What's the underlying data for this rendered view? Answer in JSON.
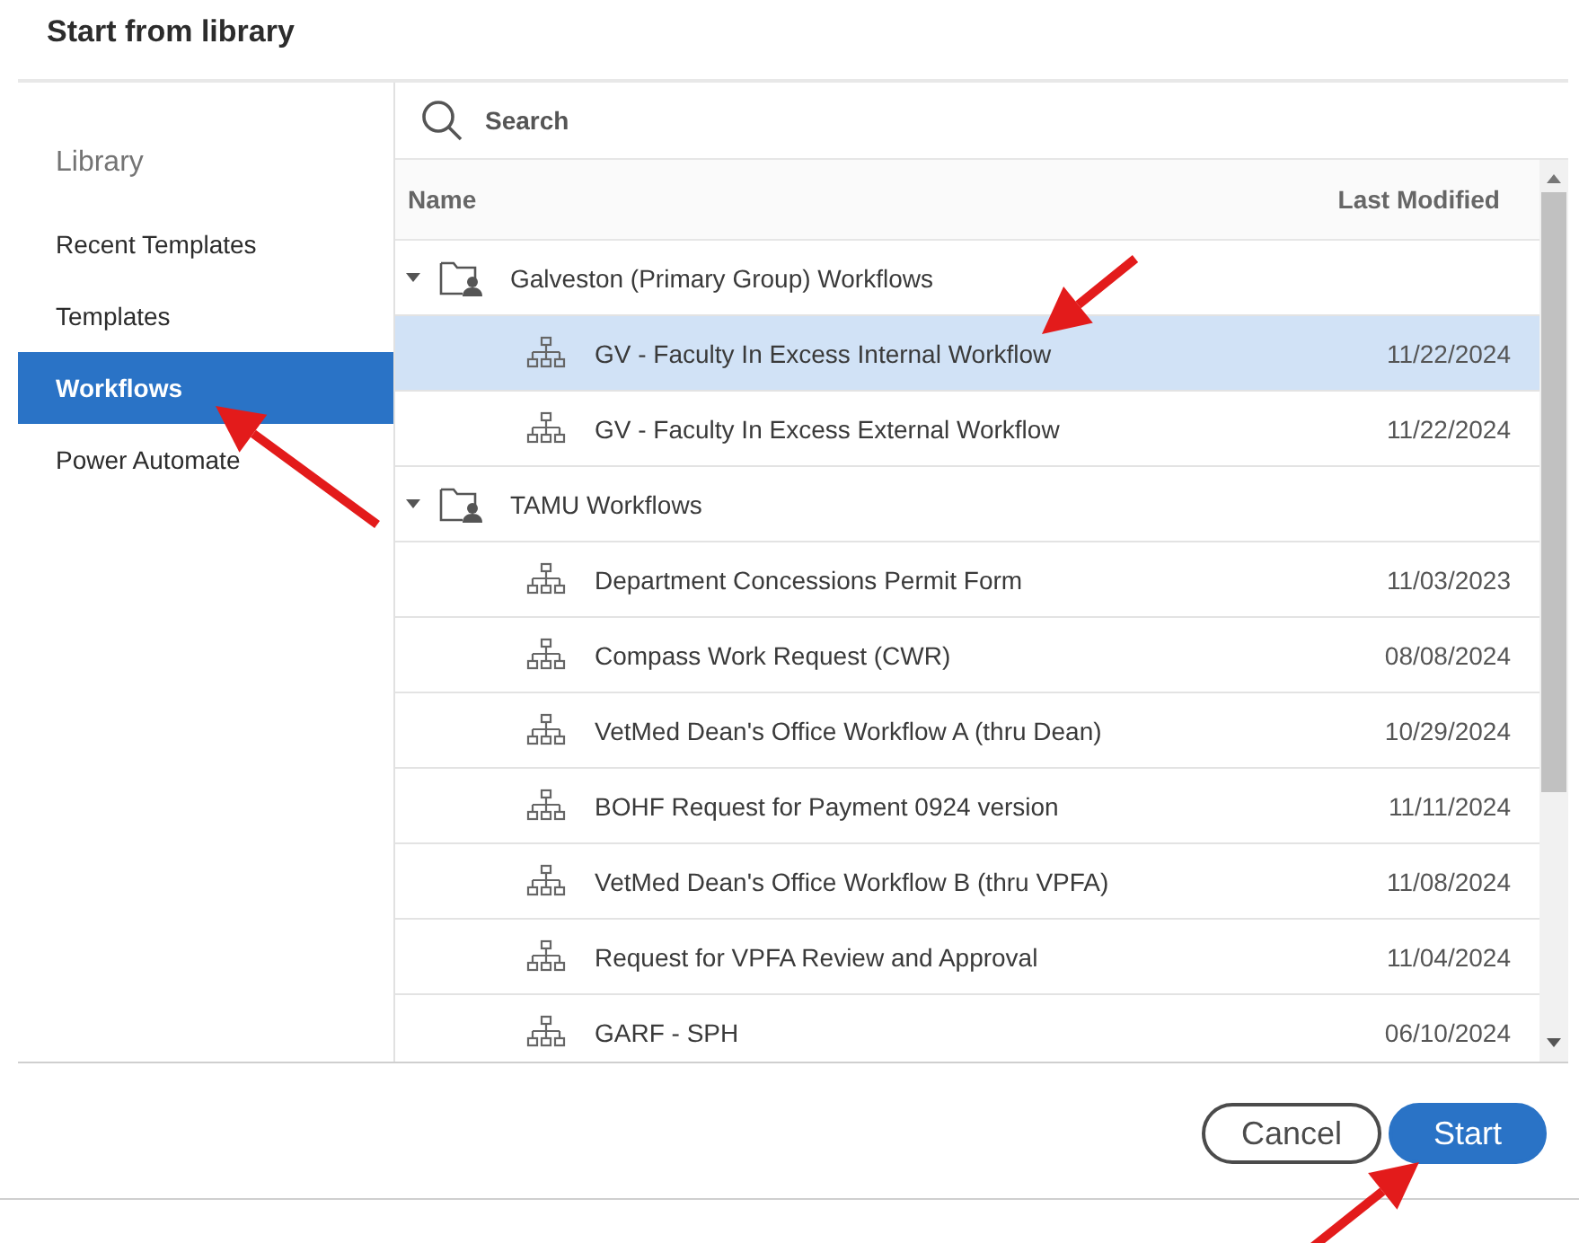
{
  "dialog": {
    "title": "Start from library"
  },
  "sidebar": {
    "heading": "Library",
    "items": [
      {
        "label": "Recent Templates",
        "selected": false,
        "callout_arrow": false
      },
      {
        "label": "Templates",
        "selected": false,
        "callout_arrow": false
      },
      {
        "label": "Workflows",
        "selected": true,
        "callout_arrow": true
      },
      {
        "label": "Power Automate",
        "selected": false,
        "callout_arrow": false
      }
    ]
  },
  "search": {
    "placeholder": "Search"
  },
  "table": {
    "columns": [
      "Name",
      "Last Modified"
    ],
    "groups": [
      {
        "name": "Galveston (Primary Group) Workflows",
        "expanded": true,
        "children": [
          {
            "name": "GV - Faculty In Excess Internal Workflow",
            "modified": "11/22/2024",
            "selected": true,
            "callout_arrow": true
          },
          {
            "name": "GV - Faculty In Excess External Workflow",
            "modified": "11/22/2024",
            "selected": false,
            "callout_arrow": false
          }
        ]
      },
      {
        "name": "TAMU Workflows",
        "expanded": true,
        "children": [
          {
            "name": "Department Concessions Permit Form",
            "modified": "11/03/2023",
            "selected": false,
            "callout_arrow": false
          },
          {
            "name": "Compass Work Request (CWR)",
            "modified": "08/08/2024",
            "selected": false,
            "callout_arrow": false
          },
          {
            "name": "VetMed Dean's Office Workflow A (thru Dean)",
            "modified": "10/29/2024",
            "selected": false,
            "callout_arrow": false
          },
          {
            "name": "BOHF Request for Payment 0924 version",
            "modified": "11/11/2024",
            "selected": false,
            "callout_arrow": false
          },
          {
            "name": "VetMed Dean's Office Workflow B (thru VPFA)",
            "modified": "11/08/2024",
            "selected": false,
            "callout_arrow": false
          },
          {
            "name": "Request for VPFA Review and Approval",
            "modified": "11/04/2024",
            "selected": false,
            "callout_arrow": false
          },
          {
            "name": "GARF - SPH",
            "modified": "06/10/2024",
            "selected": false,
            "callout_arrow": false
          }
        ]
      }
    ]
  },
  "buttons": [
    {
      "label": "Cancel",
      "kind": "secondary",
      "callout_arrow": false
    },
    {
      "label": "Start",
      "kind": "primary",
      "callout_arrow": true
    }
  ]
}
